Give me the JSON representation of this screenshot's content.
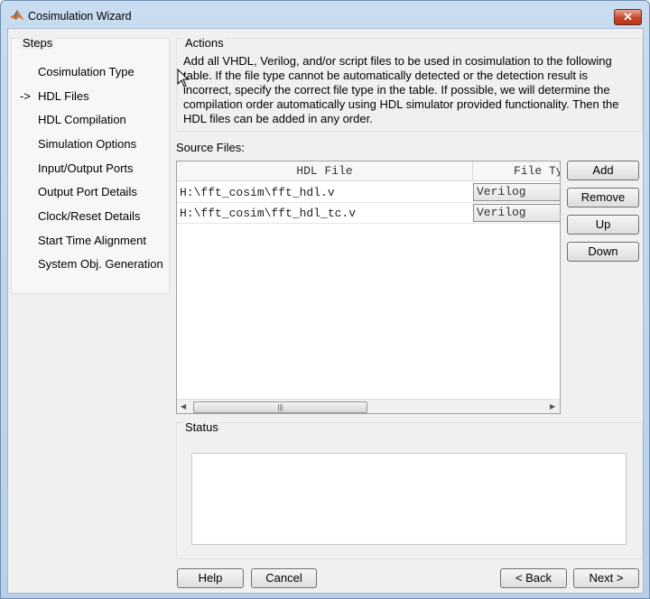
{
  "window": {
    "title": "Cosimulation Wizard",
    "close_label": "✕"
  },
  "steps": {
    "title": "Steps",
    "current_marker": "->",
    "items": [
      "Cosimulation Type",
      "HDL Files",
      "HDL Compilation",
      "Simulation Options",
      "Input/Output Ports",
      "Output Port Details",
      "Clock/Reset Details",
      "Start Time Alignment",
      "System Obj. Generation"
    ]
  },
  "actions": {
    "title": "Actions",
    "text": "Add all VHDL, Verilog, and/or script files to be used in cosimulation to the following table. If the file type cannot be automatically detected or the detection result is incorrect, specify the correct file type in the table. If possible, we will determine the compilation order automatically using HDL simulator provided functionality. Then the HDL files can be added in any order."
  },
  "source_files": {
    "label": "Source Files:",
    "columns": [
      "HDL File",
      "File Type"
    ],
    "rows": [
      {
        "file": "H:\\fft_cosim\\fft_hdl.v",
        "type": "Verilog"
      },
      {
        "file": "H:\\fft_cosim\\fft_hdl_tc.v",
        "type": "Verilog"
      }
    ],
    "buttons": {
      "add": "Add",
      "remove": "Remove",
      "up": "Up",
      "down": "Down"
    }
  },
  "status": {
    "title": "Status",
    "text": ""
  },
  "footer": {
    "help": "Help",
    "cancel": "Cancel",
    "back": "< Back",
    "next": "Next >"
  }
}
